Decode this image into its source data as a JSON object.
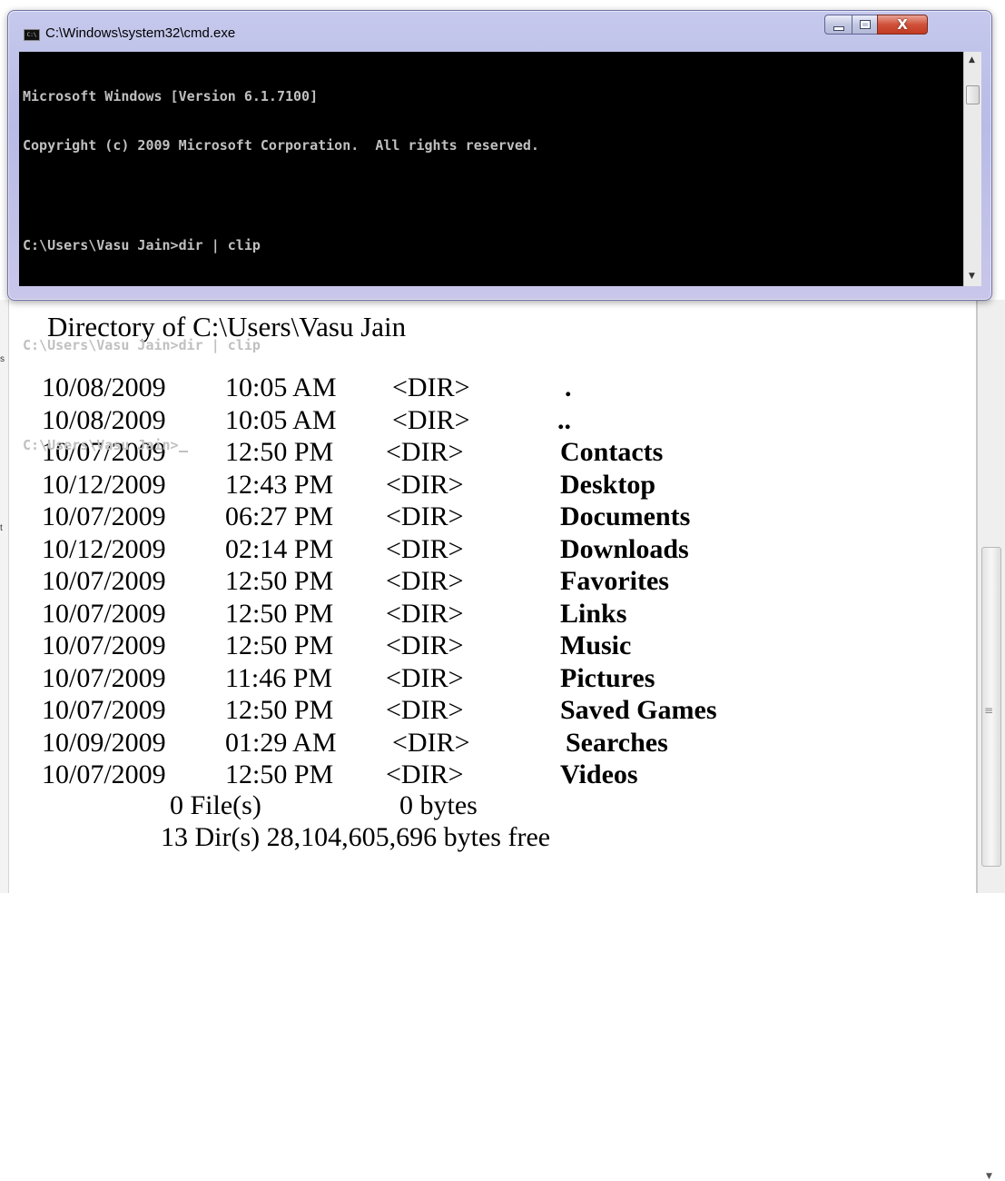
{
  "cmd_window": {
    "title": "C:\\Windows\\system32\\cmd.exe",
    "icon_label": "C:\\",
    "buttons": {
      "minimize_icon": "minimize-icon",
      "maximize_icon": "maximize-icon",
      "close_icon": "close-icon",
      "close_glyph": "X"
    },
    "console_lines": [
      "Microsoft Windows [Version 6.1.7100]",
      "Copyright (c) 2009 Microsoft Corporation.  All rights reserved.",
      "",
      "C:\\Users\\Vasu Jain>dir | clip",
      "",
      "C:\\Users\\Vasu Jain>dir | clip",
      "",
      "C:\\Users\\Vasu Jain>"
    ],
    "colors": {
      "console_bg": "#000000",
      "console_fg": "#c0c0c0",
      "close_button": "#c9432b"
    }
  },
  "document": {
    "left_edge_fragments": [
      "s",
      "t"
    ],
    "heading": "Directory of C:\\Users\\Vasu Jain",
    "entries": [
      {
        "date": "10/08/2009",
        "time": "10:05 AM",
        "type": "<DIR>",
        "name": "."
      },
      {
        "date": "10/08/2009",
        "time": "10:05 AM",
        "type": "<DIR>",
        "name": ".."
      },
      {
        "date": "10/07/2009",
        "time": "12:50 PM",
        "type": "<DIR>",
        "name": "Contacts"
      },
      {
        "date": "10/12/2009",
        "time": "12:43 PM",
        "type": "<DIR>",
        "name": "Desktop"
      },
      {
        "date": "10/07/2009",
        "time": "06:27 PM",
        "type": "<DIR>",
        "name": "Documents"
      },
      {
        "date": "10/12/2009",
        "time": "02:14 PM",
        "type": "<DIR>",
        "name": "Downloads"
      },
      {
        "date": "10/07/2009",
        "time": "12:50 PM",
        "type": "<DIR>",
        "name": "Favorites"
      },
      {
        "date": "10/07/2009",
        "time": "12:50 PM",
        "type": "<DIR>",
        "name": "Links"
      },
      {
        "date": "10/07/2009",
        "time": "12:50 PM",
        "type": "<DIR>",
        "name": "Music"
      },
      {
        "date": "10/07/2009",
        "time": "11:46 PM",
        "type": "<DIR>",
        "name": "Pictures"
      },
      {
        "date": "10/07/2009",
        "time": "12:50 PM",
        "type": "<DIR>",
        "name": "Saved Games"
      },
      {
        "date": "10/09/2009",
        "time": "01:29 AM",
        "type": "<DIR>",
        "name": "Searches"
      },
      {
        "date": "10/07/2009",
        "time": "12:50 PM",
        "type": "<DIR>",
        "name": "Videos"
      }
    ],
    "summary": {
      "files_count": "0 File(s)",
      "files_bytes": "0 bytes",
      "dirs_line": "13 Dir(s)  28,104,605,696 bytes free"
    }
  }
}
